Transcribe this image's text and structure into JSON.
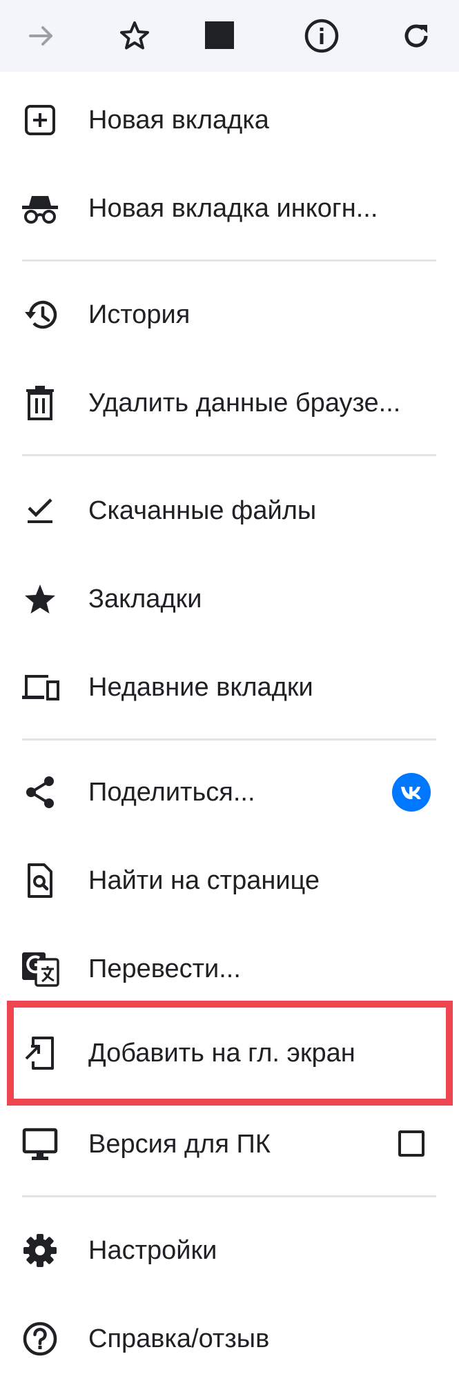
{
  "toolbar": {
    "buttons": [
      {
        "name": "forward",
        "icon": "arrow-right-icon"
      },
      {
        "name": "bookmark",
        "icon": "star-outline-icon"
      },
      {
        "name": "download",
        "icon": "square-icon"
      },
      {
        "name": "page-info",
        "icon": "info-icon"
      },
      {
        "name": "reload",
        "icon": "refresh-icon"
      }
    ]
  },
  "menu": {
    "new_tab": "Новая вкладка",
    "incognito": "Новая вкладка инкогн...",
    "history": "История",
    "clear_data": "Удалить данные браузе...",
    "downloads": "Скачанные файлы",
    "bookmarks": "Закладки",
    "recent_tabs": "Недавние вкладки",
    "share": "Поделиться...",
    "share_app_label": "VK",
    "find_in_page": "Найти на странице",
    "translate": "Перевести...",
    "add_to_home": "Добавить на гл. экран",
    "desktop_site": "Версия для ПК",
    "settings": "Настройки",
    "help": "Справка/отзыв"
  },
  "desktop_site_checked": false,
  "colors": {
    "toolbar_bg": "#f4f5fa",
    "highlight": "#ef4551",
    "vk_blue": "#0077ff",
    "icon": "#202124",
    "disabled_icon": "#9aa0a6",
    "divider": "#e3e3e3"
  }
}
